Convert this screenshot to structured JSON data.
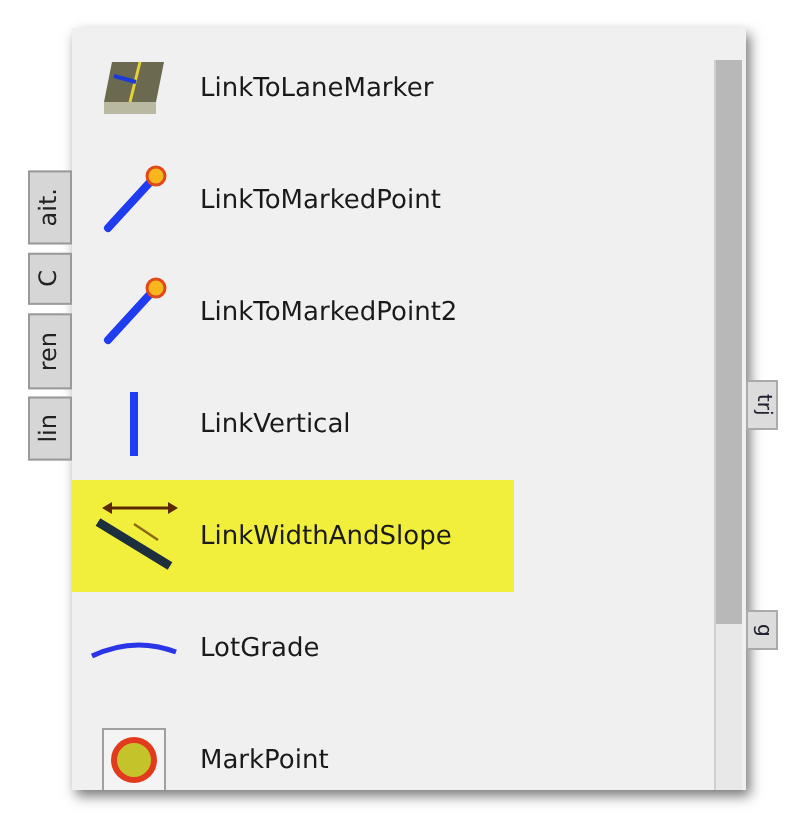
{
  "left_tabs": [
    {
      "label": "ait."
    },
    {
      "label": "C"
    },
    {
      "label": "ren"
    },
    {
      "label": "lin"
    }
  ],
  "items": [
    {
      "label": "LinkToLaneMarker",
      "kind": "lanemarker",
      "selected": false
    },
    {
      "label": "LinkToMarkedPoint",
      "kind": "markedpoint",
      "selected": false
    },
    {
      "label": "LinkToMarkedPoint2",
      "kind": "markedpoint",
      "selected": false
    },
    {
      "label": "LinkVertical",
      "kind": "vertical",
      "selected": false
    },
    {
      "label": "LinkWidthAndSlope",
      "kind": "widthslope",
      "selected": true
    },
    {
      "label": "LotGrade",
      "kind": "lotgrade",
      "selected": false
    },
    {
      "label": "MarkPoint",
      "kind": "markpoint",
      "selected": false
    }
  ],
  "right_tabs": [
    {
      "label": "trj"
    },
    {
      "label": "g"
    }
  ]
}
